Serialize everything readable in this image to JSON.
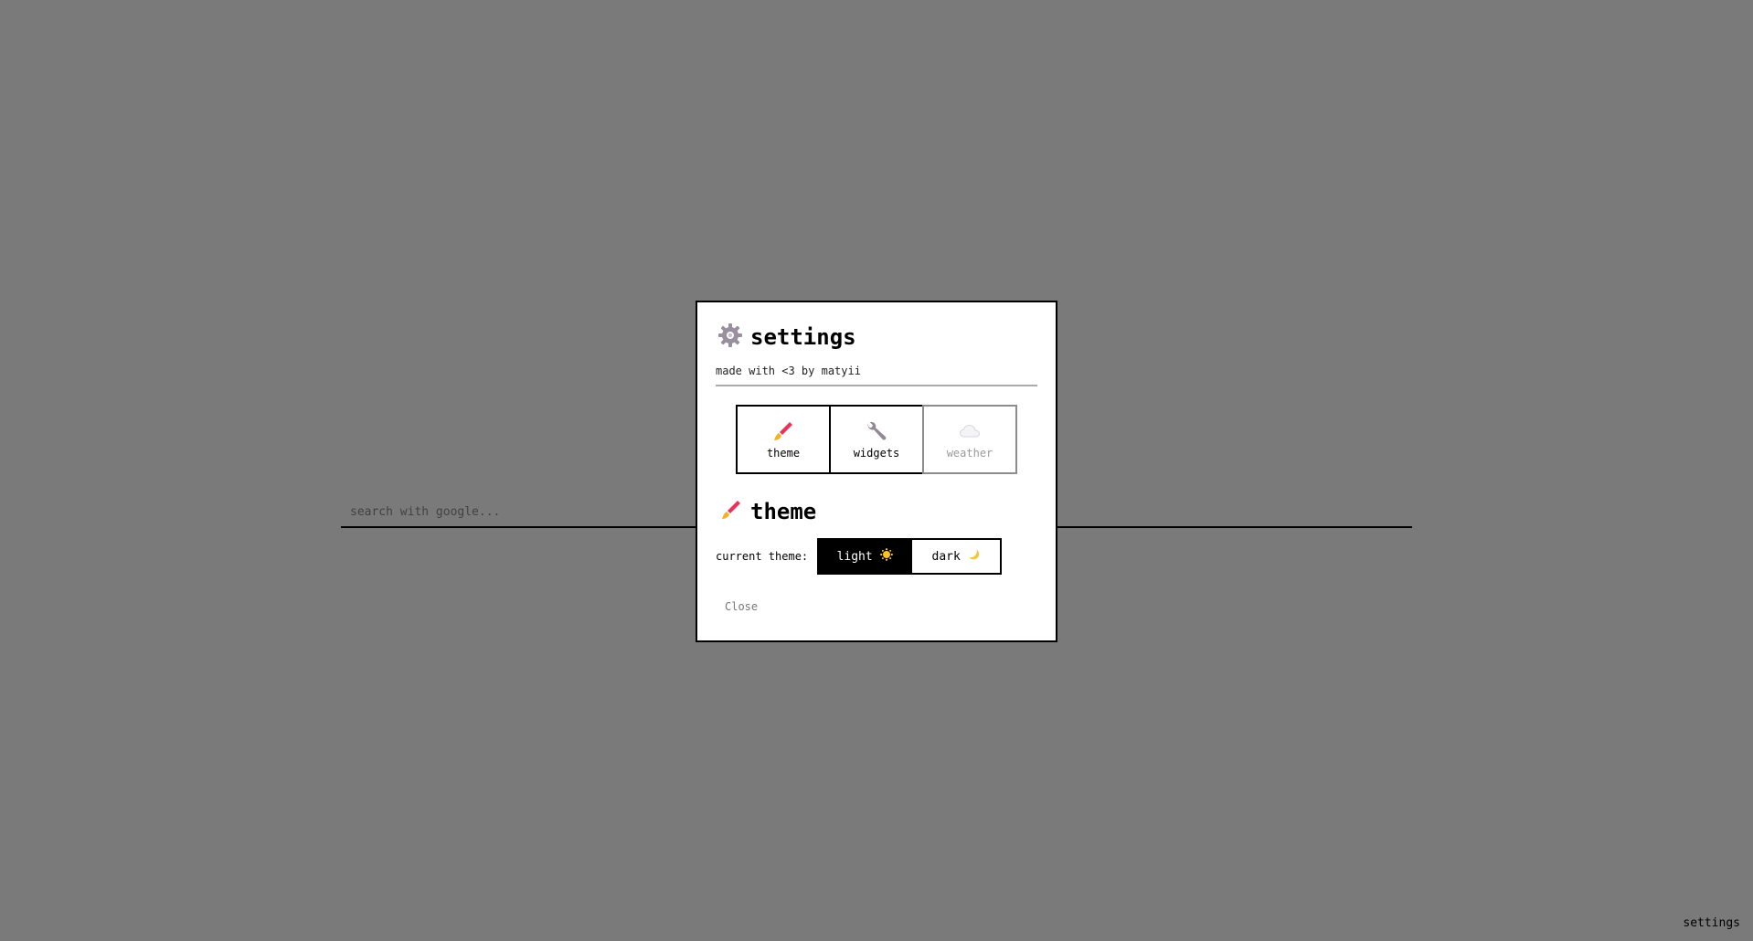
{
  "search": {
    "placeholder": "search with google..."
  },
  "footer": {
    "settings_label": "settings"
  },
  "modal": {
    "title": "settings",
    "title_icon": "gear-icon",
    "subtitle": "made with <3 by matyii",
    "tabs": [
      {
        "label": "theme",
        "icon": "paintbrush-icon",
        "enabled": true
      },
      {
        "label": "widgets",
        "icon": "wrench-icon",
        "enabled": true
      },
      {
        "label": "weather",
        "icon": "cloud-icon",
        "enabled": false
      }
    ],
    "section": {
      "title": "theme",
      "icon": "paintbrush-icon"
    },
    "theme_row": {
      "label": "current theme:",
      "options": [
        {
          "label": "light",
          "icon": "sun-icon",
          "selected": true
        },
        {
          "label": "dark",
          "icon": "moon-icon",
          "selected": false
        }
      ]
    },
    "close_label": "Close"
  },
  "colors": {
    "overlay": "#7a7a7a",
    "brush_red": "#e8345a",
    "brush_yellow": "#f5b324",
    "gear": "#9a8f9f",
    "wrench": "#8f8a96",
    "sun": "#f7c325",
    "moon": "#f2c744"
  }
}
